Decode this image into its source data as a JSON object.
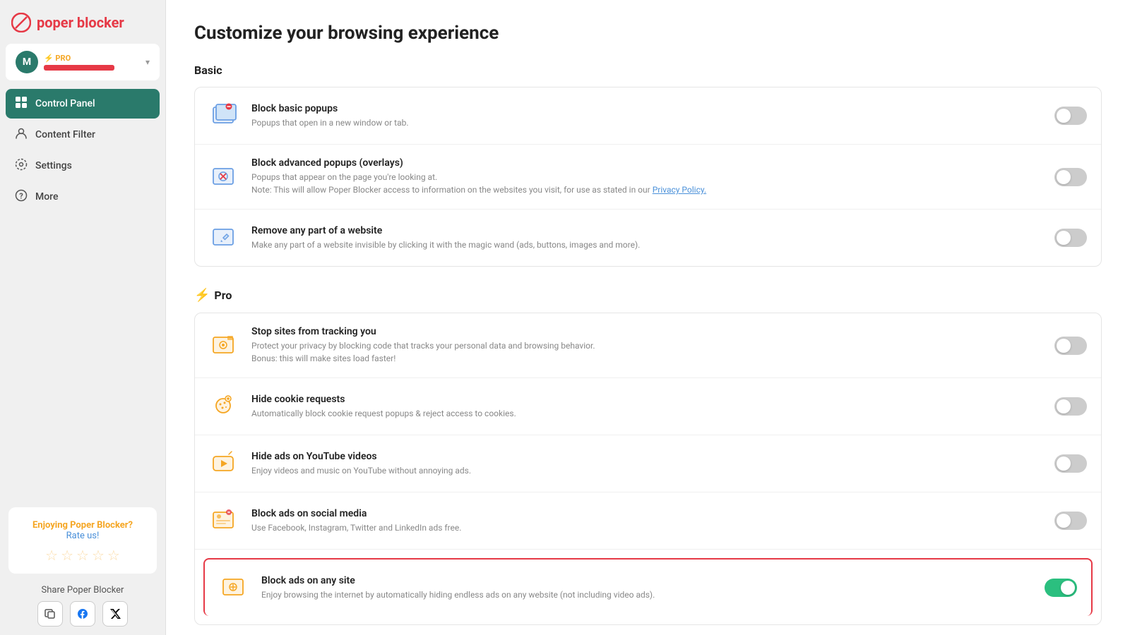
{
  "app": {
    "logo_icon": "🚫",
    "logo_text": "poper blocker"
  },
  "sidebar": {
    "user": {
      "initial": "M",
      "pro_label": "⚡ PRO",
      "chevron": "▾"
    },
    "nav_items": [
      {
        "id": "control-panel",
        "label": "Control Panel",
        "icon": "▣",
        "active": true
      },
      {
        "id": "content-filter",
        "label": "Content Filter",
        "icon": "👤",
        "active": false
      },
      {
        "id": "settings",
        "label": "Settings",
        "icon": "⊙",
        "active": false
      },
      {
        "id": "more",
        "label": "More",
        "icon": "?",
        "active": false
      }
    ],
    "enjoy": {
      "title": "Enjoying Poper Blocker?",
      "rate_label": "Rate us!"
    },
    "share": {
      "title": "Share Poper Blocker",
      "icons": [
        "copy",
        "facebook",
        "twitter"
      ]
    }
  },
  "main": {
    "page_title": "Customize your browsing experience",
    "basic_section": {
      "title": "Basic",
      "features": [
        {
          "id": "block-basic-popups",
          "title": "Block basic popups",
          "desc": "Popups that open in a new window or tab.",
          "toggle": false,
          "icon_color": "#6b9fe4"
        },
        {
          "id": "block-advanced-popups",
          "title": "Block advanced popups (overlays)",
          "desc": "Popups that appear on the page you're looking at.\nNote: This will allow Poper Blocker access to information on the websites you visit, for use as stated in our Privacy Policy.",
          "desc_link": "Privacy Policy.",
          "toggle": false,
          "icon_color": "#6b9fe4"
        },
        {
          "id": "remove-part-website",
          "title": "Remove any part of a website",
          "desc": "Make any part of a website invisible by clicking it with the magic wand (ads, buttons, images and more).",
          "toggle": false,
          "icon_color": "#6b9fe4"
        }
      ]
    },
    "pro_section": {
      "title": "Pro",
      "lightning": "⚡",
      "features": [
        {
          "id": "stop-tracking",
          "title": "Stop sites from tracking you",
          "desc": "Protect your privacy by blocking code that tracks your personal data and browsing behavior.\nBonus: this will make sites load faster!",
          "toggle": false,
          "icon_color": "#f5a623"
        },
        {
          "id": "hide-cookie-requests",
          "title": "Hide cookie requests",
          "desc": "Automatically block cookie request popups & reject access to cookies.",
          "toggle": false,
          "icon_color": "#f5a623"
        },
        {
          "id": "hide-youtube-ads",
          "title": "Hide ads on YouTube videos",
          "desc": "Enjoy videos and music on YouTube without annoying ads.",
          "toggle": false,
          "icon_color": "#f5a623"
        },
        {
          "id": "block-social-media-ads",
          "title": "Block ads on social media",
          "desc": "Use Facebook, Instagram, Twitter and LinkedIn ads free.",
          "toggle": false,
          "icon_color": "#f5a623"
        },
        {
          "id": "block-ads-any-site",
          "title": "Block ads on any site",
          "desc": "Enjoy browsing the internet by automatically hiding endless ads on any website (not including video ads).",
          "toggle": true,
          "highlighted": true,
          "icon_color": "#f5a623"
        }
      ]
    }
  }
}
